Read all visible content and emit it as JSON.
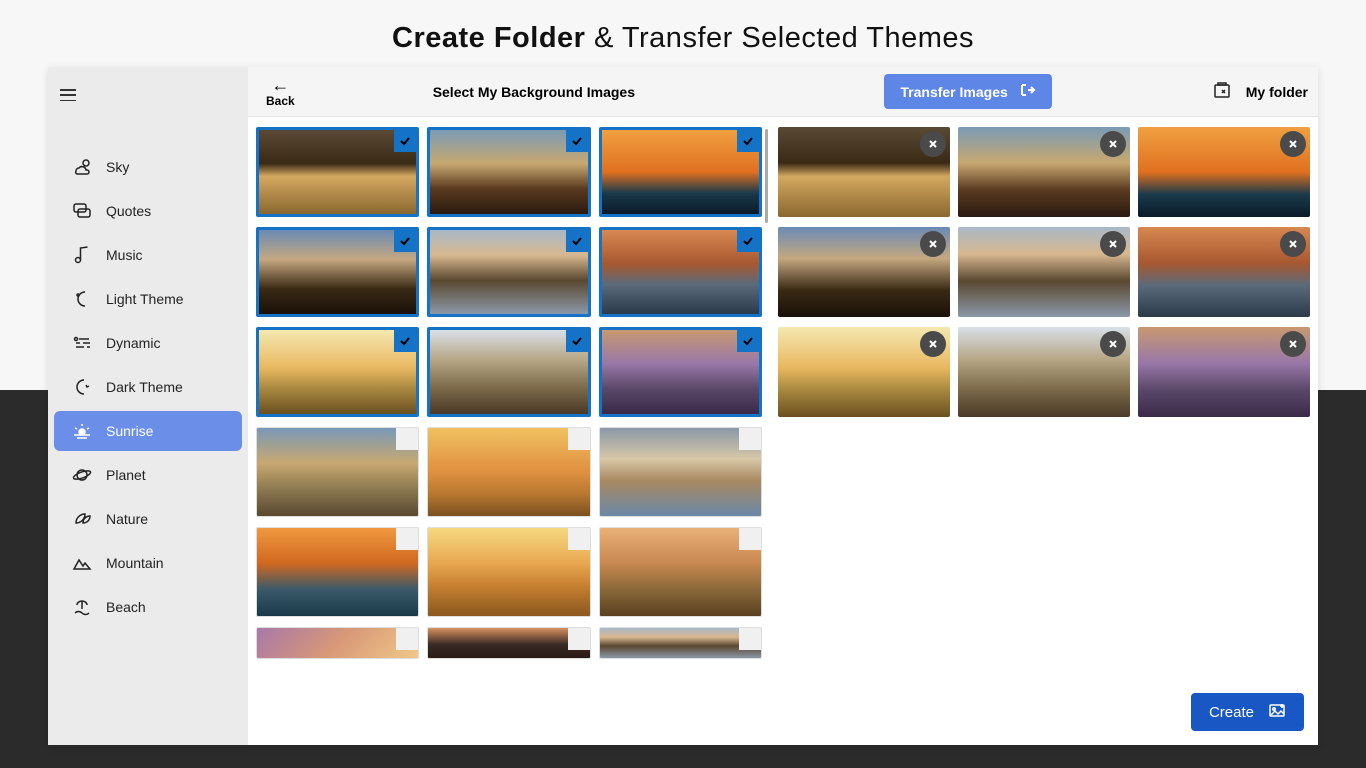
{
  "banner": {
    "bold": "Create Folder",
    "rest": " & Transfer Selected Themes"
  },
  "sidebar": {
    "items": [
      {
        "label": "Sky",
        "icon": "cloud"
      },
      {
        "label": "Quotes",
        "icon": "chat"
      },
      {
        "label": "Music",
        "icon": "note"
      },
      {
        "label": "Light Theme",
        "icon": "moon"
      },
      {
        "label": "Dynamic",
        "icon": "waves"
      },
      {
        "label": "Dark Theme",
        "icon": "moon2"
      },
      {
        "label": "Sunrise",
        "icon": "sun",
        "active": true
      },
      {
        "label": "Planet",
        "icon": "planet"
      },
      {
        "label": "Nature",
        "icon": "leaf"
      },
      {
        "label": "Mountain",
        "icon": "mountain"
      },
      {
        "label": "Beach",
        "icon": "beach"
      }
    ]
  },
  "topbar": {
    "back": "Back",
    "title": "Select My Background Images",
    "transfer": "Transfer Images",
    "folder": "My  folder"
  },
  "left_grid": [
    {
      "g": "g1",
      "sel": true
    },
    {
      "g": "g2",
      "sel": true
    },
    {
      "g": "g3",
      "sel": true
    },
    {
      "g": "g4",
      "sel": true
    },
    {
      "g": "g5",
      "sel": true
    },
    {
      "g": "g6",
      "sel": true
    },
    {
      "g": "g7",
      "sel": true
    },
    {
      "g": "g8",
      "sel": true
    },
    {
      "g": "g9",
      "sel": true
    },
    {
      "g": "g10",
      "sel": false
    },
    {
      "g": "g11",
      "sel": false
    },
    {
      "g": "g12",
      "sel": false
    },
    {
      "g": "g13",
      "sel": false
    },
    {
      "g": "g14",
      "sel": false
    },
    {
      "g": "g15",
      "sel": false
    },
    {
      "g": "g16",
      "sel": false
    },
    {
      "g": "g17",
      "sel": false
    },
    {
      "g": "g5",
      "sel": false
    }
  ],
  "right_grid": [
    {
      "g": "g1"
    },
    {
      "g": "g2"
    },
    {
      "g": "g3"
    },
    {
      "g": "g4"
    },
    {
      "g": "g5"
    },
    {
      "g": "g6"
    },
    {
      "g": "g7"
    },
    {
      "g": "g8"
    },
    {
      "g": "g9"
    }
  ],
  "create": "Create"
}
